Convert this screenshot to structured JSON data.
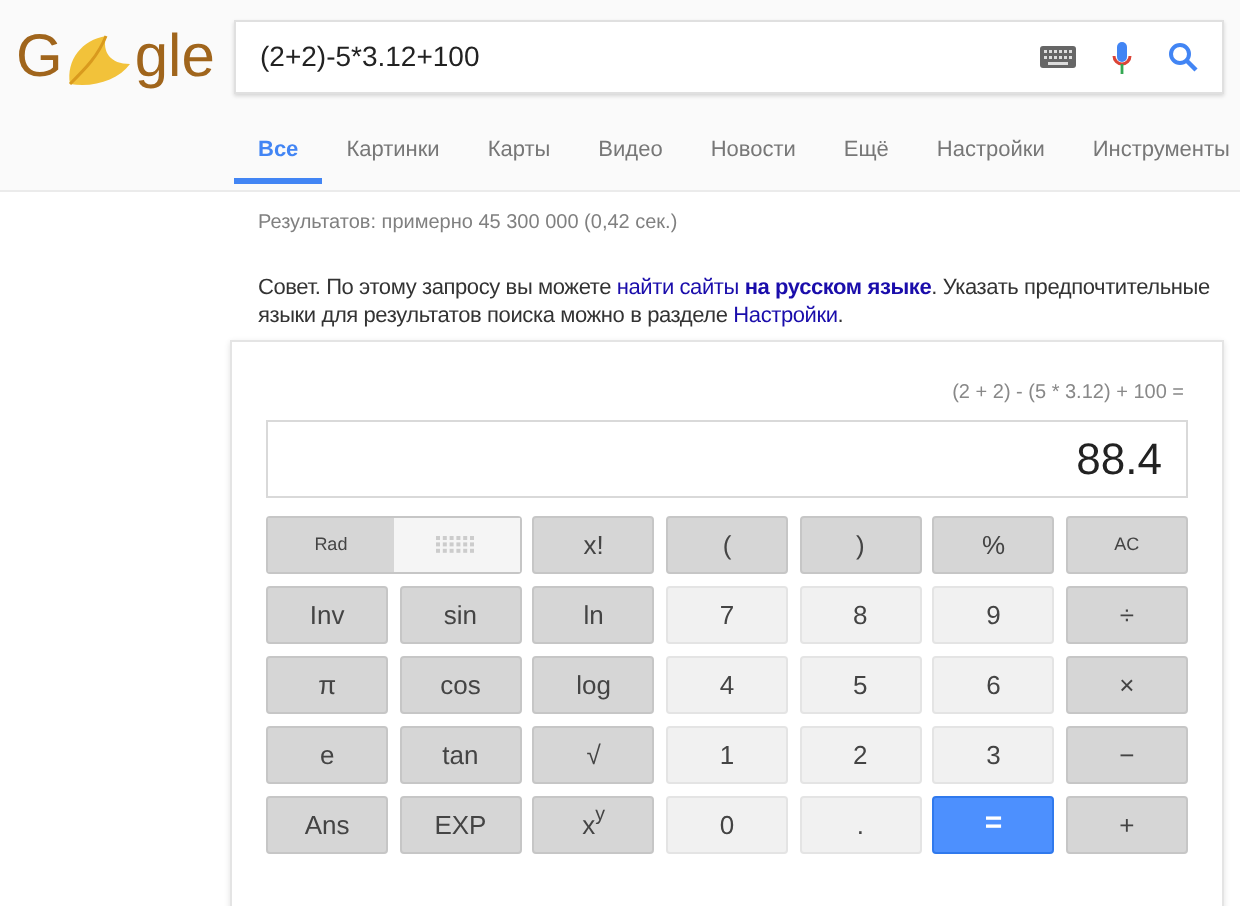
{
  "logo": {
    "left": "G",
    "right": "gle"
  },
  "search": {
    "value": "(2+2)-5*3.12+100"
  },
  "tabs": [
    {
      "label": "Все",
      "selected": true
    },
    {
      "label": "Картинки",
      "selected": false
    },
    {
      "label": "Карты",
      "selected": false
    },
    {
      "label": "Видео",
      "selected": false
    },
    {
      "label": "Новости",
      "selected": false
    },
    {
      "label": "Ещё",
      "selected": false
    },
    {
      "label": "Настройки",
      "selected": false
    },
    {
      "label": "Инструменты",
      "selected": false
    }
  ],
  "result_stats": "Результатов: примерно 45 300 000 (0,42 сек.)",
  "tip": {
    "before": "Совет. По этому запросу вы можете ",
    "link1": "найти сайты",
    "link2": "на русском языке",
    "middle": ". Указать предпочтительные языки для результатов поиска можно в разделе ",
    "link3": "Настройки",
    "after": "."
  },
  "calculator": {
    "expression": "(2 + 2) - (5 * 3.12) + 100 =",
    "display": "88.4",
    "angle_mode": [
      {
        "kind": "text",
        "label": "Rad",
        "selected": true
      },
      {
        "kind": "dots",
        "selected": false
      }
    ],
    "keys": [
      {
        "label": "x!",
        "kind": "func"
      },
      {
        "label": "(",
        "kind": "func"
      },
      {
        "label": ")",
        "kind": "func"
      },
      {
        "label": "%",
        "kind": "func"
      },
      {
        "label": "AC",
        "kind": "small"
      },
      {
        "label": "Inv",
        "kind": "func"
      },
      {
        "label": "sin",
        "kind": "func"
      },
      {
        "label": "ln",
        "kind": "func"
      },
      {
        "label": "7",
        "kind": "num"
      },
      {
        "label": "8",
        "kind": "num"
      },
      {
        "label": "9",
        "kind": "num"
      },
      {
        "label": "÷",
        "kind": "func"
      },
      {
        "label": "π",
        "kind": "func"
      },
      {
        "label": "cos",
        "kind": "func"
      },
      {
        "label": "log",
        "kind": "func"
      },
      {
        "label": "4",
        "kind": "num"
      },
      {
        "label": "5",
        "kind": "num"
      },
      {
        "label": "6",
        "kind": "num"
      },
      {
        "label": "×",
        "kind": "func"
      },
      {
        "label": "e",
        "kind": "func"
      },
      {
        "label": "tan",
        "kind": "func"
      },
      {
        "label": "√",
        "kind": "func"
      },
      {
        "label": "1",
        "kind": "num"
      },
      {
        "label": "2",
        "kind": "num"
      },
      {
        "label": "3",
        "kind": "num"
      },
      {
        "label": "−",
        "kind": "func"
      },
      {
        "label": "Ans",
        "kind": "func"
      },
      {
        "label": "EXP",
        "kind": "func"
      },
      {
        "label": "x$^{y}$",
        "kind": "func"
      },
      {
        "label": "0",
        "kind": "num"
      },
      {
        "label": ".",
        "kind": "num"
      },
      {
        "label": "=",
        "kind": "equals"
      },
      {
        "label": "+",
        "kind": "func"
      }
    ]
  }
}
